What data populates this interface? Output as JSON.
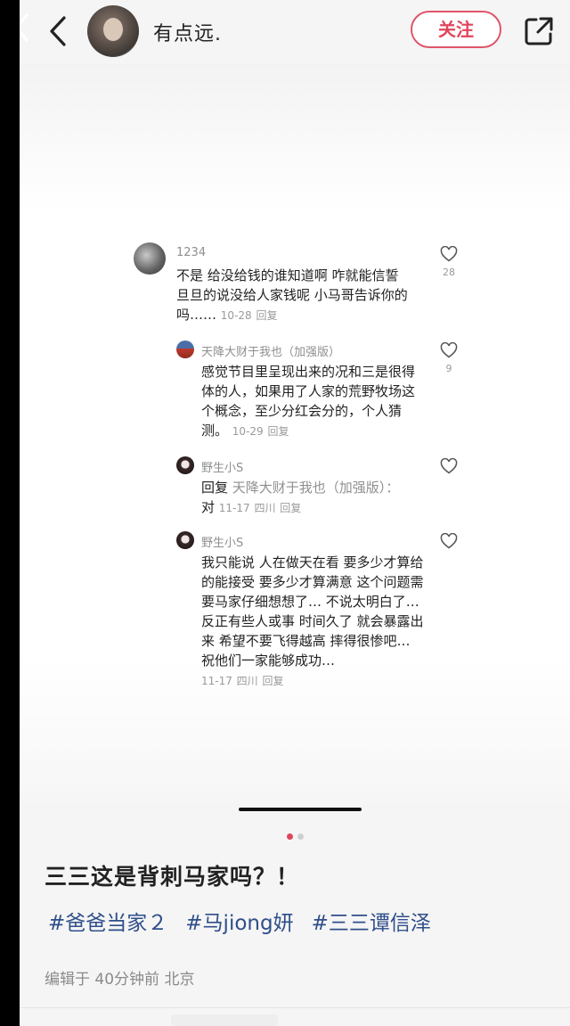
{
  "header": {
    "author_name": "有点远.",
    "follow_label": "关注"
  },
  "comments": [
    {
      "user": "1234",
      "text": "不是 给没给钱的谁知道啊 咋就能信誓旦旦的说没给人家钱呢 小马哥告诉你的吗……",
      "date": "10-28",
      "reply_label": "回复",
      "likes": "28"
    },
    {
      "user": "天降大财于我也（加强版）",
      "text": "感觉节目里呈现出来的况和三是很得体的人，如果用了人家的荒野牧场这个概念，至少分红会分的，个人猜测。",
      "date": "10-29",
      "reply_label": "回复",
      "likes": "9"
    },
    {
      "user": "野生小S",
      "reply_prefix": "回复",
      "reply_target": "天降大财于我也（加强版）：",
      "text": "对",
      "date": "11-17",
      "location": "四川",
      "reply_label": "回复"
    },
    {
      "user": "野生小S",
      "text": "我只能说 人在做天在看 要多少才算给的能接受 要多少才算满意 这个问题需要马家仔细想想了… 不说太明白了… 反正有些人或事 时间久了 就会暴露出来 希望不要飞得越高 摔得很惨吧… 祝他们一家能够成功…",
      "date": "11-17",
      "location": "四川",
      "reply_label": "回复"
    }
  ],
  "post": {
    "title": "三三这是背刺马家吗？！",
    "tags": [
      "#爸爸当家２",
      "#马jiong妍",
      "#三三谭信泽"
    ],
    "edit_meta": "编辑于 40分钟前 北京"
  },
  "colors": {
    "accent": "#e0455c",
    "tag": "#2f4e8a"
  }
}
